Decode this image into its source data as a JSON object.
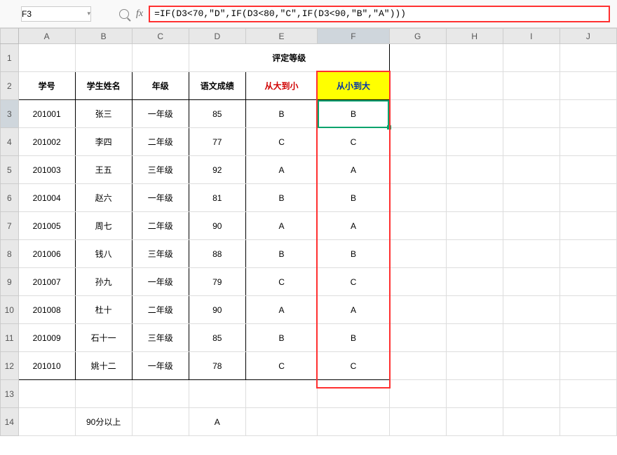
{
  "nameBox": "F3",
  "fxLabel": "fx",
  "formula": "=IF(D3<70,\"D\",IF(D3<80,\"C\",IF(D3<90,\"B\",\"A\")))",
  "columns": [
    "A",
    "B",
    "C",
    "D",
    "E",
    "F",
    "G",
    "H",
    "I",
    "J"
  ],
  "rowNumbers": [
    "1",
    "2",
    "3",
    "4",
    "5",
    "6",
    "7",
    "8",
    "9",
    "10",
    "11",
    "12",
    "13",
    "14"
  ],
  "mergedHeader": "评定等级",
  "headers2": {
    "A": "学号",
    "B": "学生姓名",
    "C": "年级",
    "D": "语文成绩",
    "E": "从大到小",
    "F": "从小到大"
  },
  "rows": [
    {
      "A": "201001",
      "B": "张三",
      "C": "一年级",
      "D": "85",
      "E": "B",
      "F": "B"
    },
    {
      "A": "201002",
      "B": "李四",
      "C": "二年级",
      "D": "77",
      "E": "C",
      "F": "C"
    },
    {
      "A": "201003",
      "B": "王五",
      "C": "三年级",
      "D": "92",
      "E": "A",
      "F": "A"
    },
    {
      "A": "201004",
      "B": "赵六",
      "C": "一年级",
      "D": "81",
      "E": "B",
      "F": "B"
    },
    {
      "A": "201005",
      "B": "周七",
      "C": "二年级",
      "D": "90",
      "E": "A",
      "F": "A"
    },
    {
      "A": "201006",
      "B": "钱八",
      "C": "三年级",
      "D": "88",
      "E": "B",
      "F": "B"
    },
    {
      "A": "201007",
      "B": "孙九",
      "C": "一年级",
      "D": "79",
      "E": "C",
      "F": "C"
    },
    {
      "A": "201008",
      "B": "杜十",
      "C": "二年级",
      "D": "90",
      "E": "A",
      "F": "A"
    },
    {
      "A": "201009",
      "B": "石十一",
      "C": "三年级",
      "D": "85",
      "E": "B",
      "F": "B"
    },
    {
      "A": "201010",
      "B": "姚十二",
      "C": "一年级",
      "D": "78",
      "E": "C",
      "F": "C"
    }
  ],
  "footer": {
    "text": "90分以上",
    "grade": "A"
  },
  "activeCell": "F3",
  "activeColIndex": 5,
  "activeRowIndex": 2
}
